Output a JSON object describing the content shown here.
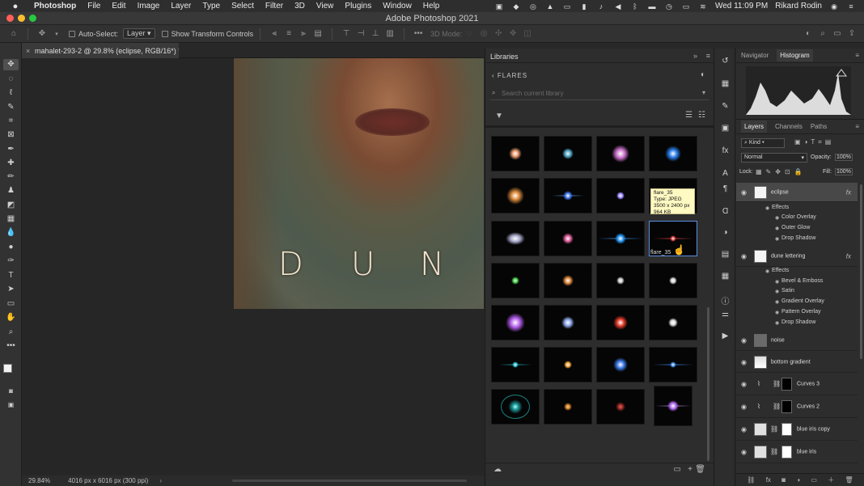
{
  "menubar": {
    "apple": "",
    "app": "Photoshop",
    "items": [
      "File",
      "Edit",
      "Image",
      "Layer",
      "Type",
      "Select",
      "Filter",
      "3D",
      "View",
      "Plugins",
      "Window",
      "Help"
    ],
    "datetime": "Wed 11:09 PM",
    "user": "Rikard Rodin"
  },
  "window": {
    "title": "Adobe Photoshop 2021"
  },
  "options": {
    "auto_select_label": "Auto-Select:",
    "auto_select_value": "Layer",
    "transform_label": "Show Transform Controls",
    "mode3d_label": "3D Mode:"
  },
  "document": {
    "tab_title": "mahalet-293-2 @ 29.8% (eclipse, RGB/16*) *",
    "zoom": "29.84%",
    "size_info": "4016 px x 6016 px (300 ppi)",
    "logo_letters": [
      "D",
      "U",
      "N"
    ]
  },
  "libraries": {
    "tab": "Libraries",
    "breadcrumb": "FLARES",
    "search_placeholder": "Search current library",
    "hover_name": "flare_35",
    "tooltip": [
      "flare_35",
      "Type: JPEG",
      "3500 x 2400 px",
      "964 KB"
    ]
  },
  "histogram": {
    "tabs": [
      "Navigator",
      "Histogram"
    ],
    "active": "Histogram"
  },
  "layers": {
    "tabs": [
      "Layers",
      "Channels",
      "Paths"
    ],
    "filter": "Kind",
    "blend_mode": "Normal",
    "opacity_label": "Opacity:",
    "opacity": "100%",
    "lock_label": "Lock:",
    "fill_label": "Fill:",
    "fill": "100%",
    "items": [
      {
        "name": "eclipse",
        "fx": "fx",
        "effects_label": "Effects",
        "effects": [
          "Color Overlay",
          "Outer Glow",
          "Drop Shadow"
        ]
      },
      {
        "name": "dune lettering",
        "fx": "fx",
        "effects_label": "Effects",
        "effects": [
          "Bevel & Emboss",
          "Satin",
          "Gradient Overlay",
          "Pattern Overlay",
          "Drop Shadow"
        ]
      },
      {
        "name": "noise"
      },
      {
        "name": "bottom gradient"
      },
      {
        "name": "Curves 3"
      },
      {
        "name": "Curves 2"
      },
      {
        "name": "blue iris copy"
      },
      {
        "name": "blue iris"
      }
    ]
  },
  "colors": {
    "menubar": "#2e2e2e",
    "panel": "#2d2d2d",
    "tooltip": "#fff9c2",
    "traffic": [
      "#fe5f57",
      "#febc2e",
      "#28c840"
    ]
  }
}
